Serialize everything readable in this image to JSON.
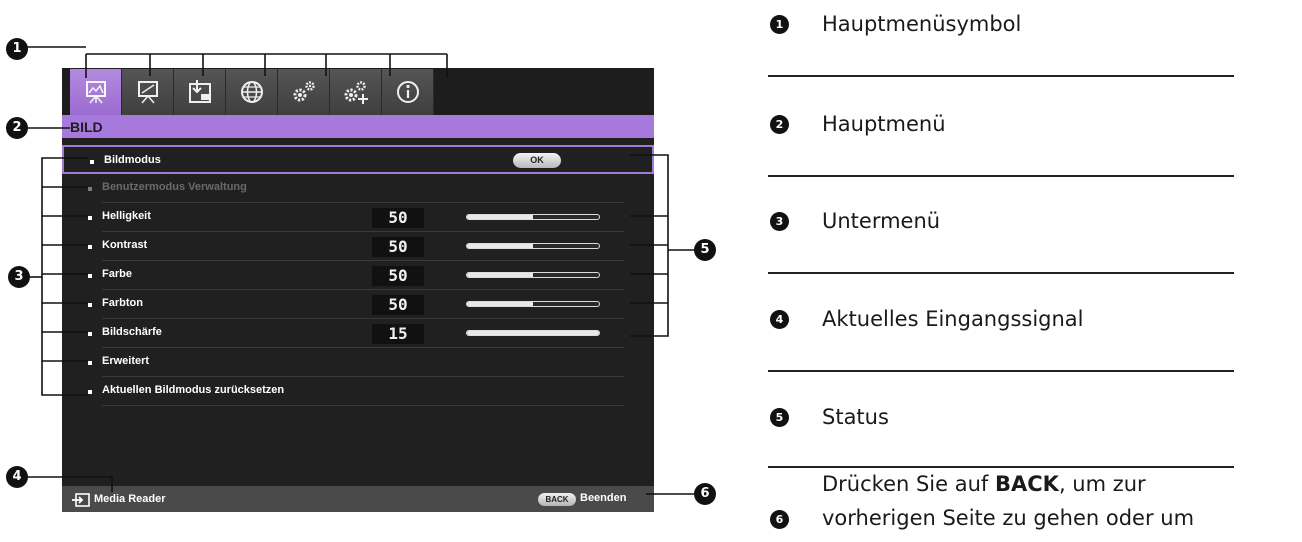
{
  "osd": {
    "tabs": [
      {
        "icon": "picture-icon",
        "active": true
      },
      {
        "icon": "display-icon",
        "active": false
      },
      {
        "icon": "input-icon",
        "active": false
      },
      {
        "icon": "globe-icon",
        "active": false
      },
      {
        "icon": "system-settings-icon",
        "active": false
      },
      {
        "icon": "advanced-settings-icon",
        "active": false
      },
      {
        "icon": "info-icon",
        "active": false
      }
    ],
    "menu_title": "BILD",
    "rows": [
      {
        "label": "Bildmodus",
        "button": "OK",
        "selected": true
      },
      {
        "label": "Benutzermodus Verwaltung",
        "disabled": true
      },
      {
        "label": "Helligkeit",
        "value": "50",
        "level": 0.5
      },
      {
        "label": "Kontrast",
        "value": "50",
        "level": 0.5
      },
      {
        "label": "Farbe",
        "value": "50",
        "level": 0.5
      },
      {
        "label": "Farbton",
        "value": "50",
        "level": 0.5
      },
      {
        "label": "Bildschärfe",
        "value": "15",
        "level": 1.0
      },
      {
        "label": "Erweitert"
      },
      {
        "label": "Aktuellen Bildmodus zurücksetzen"
      }
    ],
    "status": {
      "source_icon": "input-source-icon",
      "source_label": "Media Reader",
      "back_button": "BACK",
      "back_label": "Beenden"
    }
  },
  "callouts": [
    "1",
    "2",
    "3",
    "4",
    "5",
    "6"
  ],
  "legend": [
    {
      "num": "1",
      "text": "Hauptmenüsymbol"
    },
    {
      "num": "2",
      "text": "Hauptmenü"
    },
    {
      "num": "3",
      "text": "Untermenü"
    },
    {
      "num": "4",
      "text": "Aktuelles Eingangssignal"
    },
    {
      "num": "5",
      "text": "Status"
    },
    {
      "num": "6",
      "text_before": "Drücken Sie auf ",
      "text_bold": "BACK",
      "text_after": ", um zur",
      "text_line2": "vorherigen Seite zu gehen oder um"
    }
  ]
}
